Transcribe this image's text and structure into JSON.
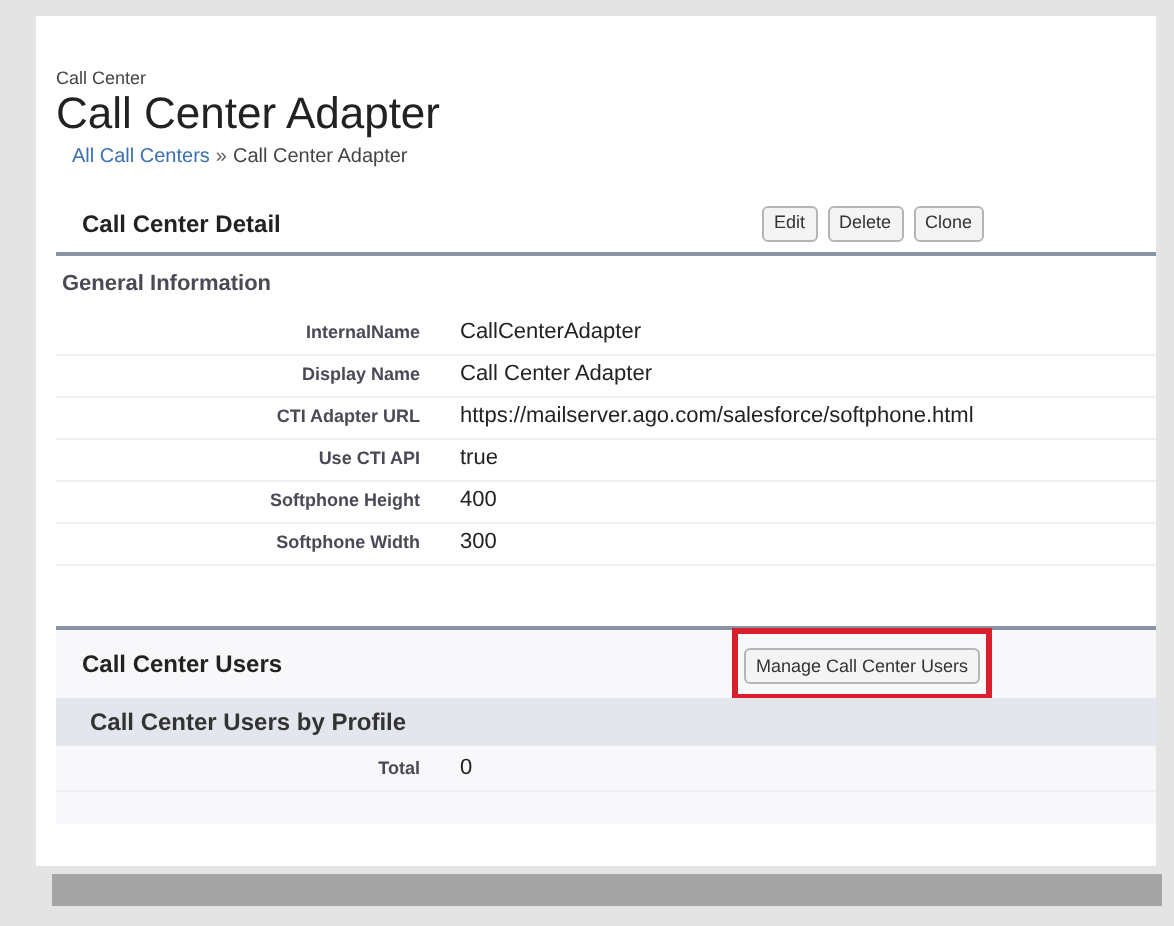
{
  "header": {
    "caption": "Call Center",
    "title": "Call Center Adapter"
  },
  "breadcrumb": {
    "link": "All Call Centers",
    "separator": "»",
    "current": "Call Center Adapter"
  },
  "detail": {
    "title": "Call Center Detail",
    "buttons": [
      "Edit",
      "Delete",
      "Clone"
    ],
    "section": "General Information",
    "fields": [
      {
        "label": "InternalName",
        "value": "CallCenterAdapter"
      },
      {
        "label": "Display Name",
        "value": "Call Center Adapter"
      },
      {
        "label": "CTI Adapter URL",
        "value": "https://mailserver.ago.com/salesforce/softphone.html"
      },
      {
        "label": "Use CTI API",
        "value": "true"
      },
      {
        "label": "Softphone Height",
        "value": "400"
      },
      {
        "label": "Softphone Width",
        "value": "300"
      }
    ]
  },
  "users": {
    "title": "Call Center Users",
    "button": {
      "label": "Manage Call Center Users",
      "highlighted": true
    },
    "section": "Call Center Users by Profile",
    "fields": [
      {
        "label": "Total",
        "value": "0"
      }
    ]
  }
}
